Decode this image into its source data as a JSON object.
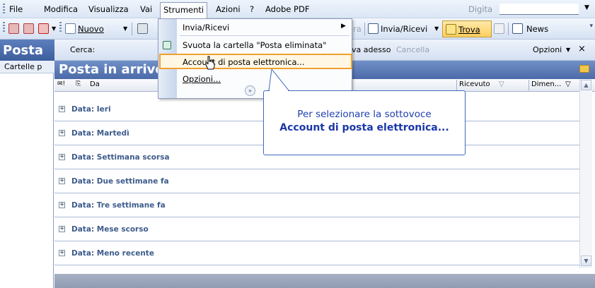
{
  "menubar": {
    "items": [
      "File",
      "Modifica",
      "Visualizza",
      "Vai",
      "Strumenti",
      "Azioni",
      "?",
      "Adobe PDF"
    ],
    "search_hint": "Digita"
  },
  "toolbar": {
    "new_label": "Nuovo",
    "rispondi_partial": "ra",
    "sendrecv_label": "Invia/Ricevi",
    "find_label": "Trova",
    "news_label": "News"
  },
  "nav": {
    "title": "Posta",
    "subtitle": "Cartelle p"
  },
  "searchbar": {
    "label": "Cerca:",
    "search_now": "va adesso",
    "cancel": "Cancella",
    "options": "Opzioni",
    "close": "×"
  },
  "folder": {
    "title": "Posta in arrivo"
  },
  "columns": {
    "from": "Da",
    "received": "Ricevuto",
    "size": "Dimen..."
  },
  "groups": [
    "Data: Ieri",
    "Data: Martedì",
    "Data: Settimana scorsa",
    "Data: Due settimane fa",
    "Data: Tre settimane fa",
    "Data: Mese scorso",
    "Data: Meno recente"
  ],
  "dropdown": {
    "items": [
      "Invia/Ricevi",
      "Svuota la cartella \"Posta eliminata\"",
      "Account di posta elettronica...",
      "Opzioni..."
    ]
  },
  "callout": {
    "line1": "Per selezionare la sottovoce",
    "line2": "Account di posta elettronica..."
  },
  "colors": {
    "accent": "#4b6aa8",
    "highlight": "#f0a030",
    "callout_text": "#1f3fb0"
  }
}
